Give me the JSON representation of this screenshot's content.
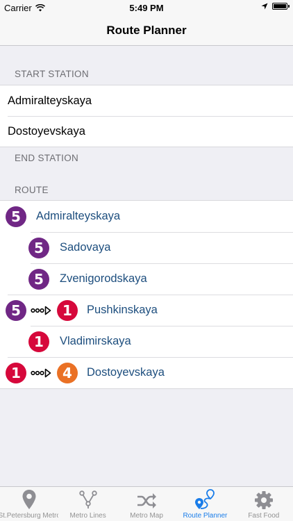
{
  "status_bar": {
    "carrier": "Carrier",
    "time": "5:49 PM"
  },
  "nav": {
    "title": "Route Planner"
  },
  "start_section": {
    "header": "START STATION",
    "items": [
      "Admiralteyskaya",
      "Dostoyevskaya"
    ]
  },
  "end_section": {
    "header": "END STATION"
  },
  "route_section": {
    "header": "ROUTE",
    "steps": [
      {
        "line": "5",
        "name": "Admiralteyskaya"
      },
      {
        "line": "5",
        "name": "Sadovaya"
      },
      {
        "line": "5",
        "name": "Zvenigorodskaya"
      },
      {
        "from_line": "5",
        "line": "1",
        "name": "Pushkinskaya"
      },
      {
        "line": "1",
        "name": "Vladimirskaya"
      },
      {
        "from_line": "1",
        "line": "4",
        "name": "Dostoyevskaya"
      }
    ]
  },
  "line_colors": {
    "1": "#d6083b",
    "4": "#ea7125",
    "5": "#702785"
  },
  "tabs": [
    {
      "label": "St.Petersburg Metro",
      "icon": "map-pin-icon"
    },
    {
      "label": "Metro Lines",
      "icon": "metro-lines-icon"
    },
    {
      "label": "Metro Map",
      "icon": "shuffle-icon"
    },
    {
      "label": "Route Planner",
      "icon": "route-planner-icon",
      "active": true
    },
    {
      "label": "Fast Food",
      "icon": "gear-icon"
    }
  ]
}
